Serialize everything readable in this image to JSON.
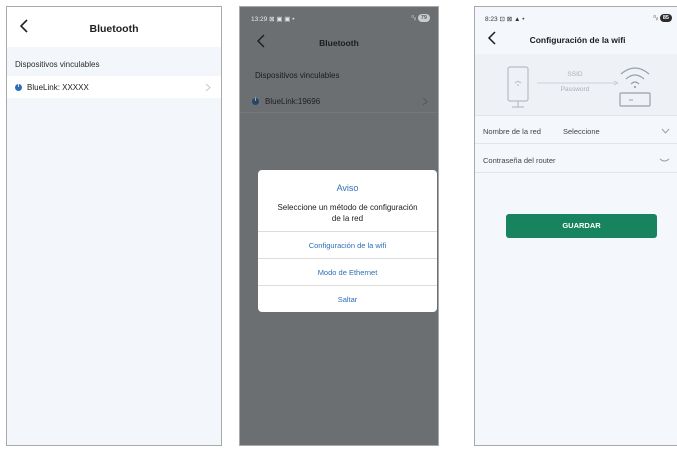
{
  "screen1": {
    "header": {
      "title": "Bluetooth"
    },
    "section_label": "Dispositivos vinculables",
    "device": {
      "info_icon_glyph": "i",
      "name": "BlueLink: XXXXX"
    }
  },
  "screen2": {
    "status_bar": {
      "time_icons": "13:29 ⊠ ▣ ▣ •",
      "signal": "⁰ᵢₗ",
      "battery": "79"
    },
    "header": {
      "title": "Bluetooth"
    },
    "section_label": "Dispositivos vinculables",
    "device": {
      "info_icon_glyph": "i",
      "name": "BlueLink:19696"
    },
    "dialog": {
      "title": "Aviso",
      "message": "Seleccione un método de configuración de la red",
      "options": [
        "Configuración de la wifi",
        "Modo de Ethernet",
        "Saltar"
      ]
    }
  },
  "screen3": {
    "status_bar": {
      "time_icons": "8:23 ⊡ ⊠ ▲ •",
      "signal": "⁰ᵢₗ",
      "battery": "85"
    },
    "header": {
      "title": "Configuración de la wifi"
    },
    "illustration": {
      "ssid_label": "SSID",
      "password_label": "Password"
    },
    "fields": {
      "network_label": "Nombre de la red",
      "network_value": "Seleccione",
      "password_label": "Contraseña del router"
    },
    "save_label": "GUARDAR"
  },
  "colors": {
    "accent_blue": "#2d6fb5",
    "save_green": "#17845f",
    "dim_overlay": "#6b6f72"
  }
}
